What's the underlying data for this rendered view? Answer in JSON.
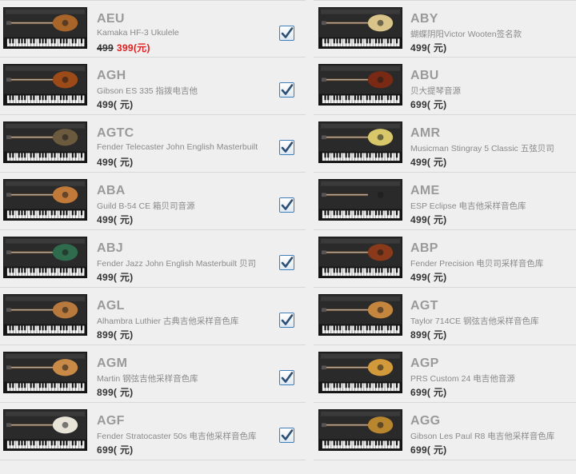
{
  "left": [
    {
      "code": "AEU",
      "name": "Kamaka HF-3 Ukulele",
      "old_price": "499",
      "price": "399(元)",
      "checked": true,
      "body_color": "#a8652a"
    },
    {
      "code": "AGH",
      "name": "Gibson ES 335 指拨电吉他",
      "price": "499( 元)",
      "checked": true,
      "body_color": "#9c4a18"
    },
    {
      "code": "AGTC",
      "name": "Fender Telecaster John English Masterbuilt",
      "price": "499( 元)",
      "checked": true,
      "body_color": "#6b5a3d"
    },
    {
      "code": "ABA",
      "name": "Guild B-54 CE 箱贝司音源",
      "price": "499( 元)",
      "checked": true,
      "body_color": "#c27a3a"
    },
    {
      "code": "ABJ",
      "name": "Fender Jazz John English Masterbuilt 贝司",
      "price": "499( 元)",
      "checked": true,
      "body_color": "#2f6b4d"
    },
    {
      "code": "AGL",
      "name": "Alhambra Luthier 古典吉他采样音色库",
      "price": "899( 元)",
      "checked": true,
      "body_color": "#b7793c"
    },
    {
      "code": "AGM",
      "name": "Martin 钢弦吉他采样音色库",
      "price": "899( 元)",
      "checked": true,
      "body_color": "#c98a47"
    },
    {
      "code": "AGF",
      "name": "Fender Stratocaster 50s 电吉他采样音色库",
      "price": "699( 元)",
      "checked": true,
      "body_color": "#e8e4d8"
    }
  ],
  "right": [
    {
      "code": "ABY",
      "name": "蝴蝶阴阳Victor Wooten签名款",
      "price": "499( 元)",
      "body_color": "#d9c48a"
    },
    {
      "code": "ABU",
      "name": "贝大提琴音源",
      "price": "699( 元)",
      "body_color": "#7a2a14"
    },
    {
      "code": "AMR",
      "name": "Musicman Stingray 5 Classic 五弦贝司",
      "price": "499( 元)",
      "body_color": "#d8c86a"
    },
    {
      "code": "AME",
      "name": "ESP Eclipse 电吉他采样音色库",
      "price": "499( 元)",
      "body_color": "#2a2a2a"
    },
    {
      "code": "ABP",
      "name": "Fender Precision 电贝司采样音色库",
      "price": "499( 元)",
      "body_color": "#8a3a1a"
    },
    {
      "code": "AGT",
      "name": "Taylor 714CE 钢弦吉他采样音色库",
      "price": "899( 元)",
      "body_color": "#c4853e"
    },
    {
      "code": "AGP",
      "name": "PRS Custom 24 电吉他音源",
      "price": "699( 元)",
      "body_color": "#d29a3a"
    },
    {
      "code": "AGG",
      "name": "Gibson Les Paul R8 电吉他采样音色库",
      "price": "699( 元)",
      "body_color": "#b8862f"
    }
  ]
}
